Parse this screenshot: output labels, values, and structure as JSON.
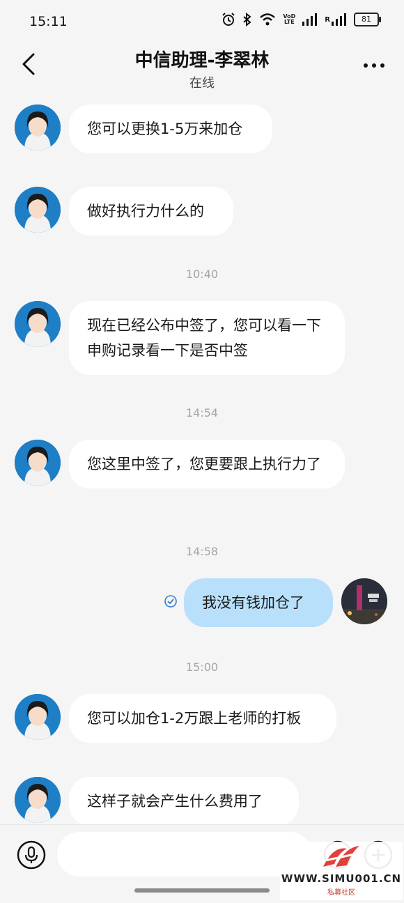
{
  "status_bar": {
    "time": "15:11",
    "network_labels": [
      "VoD",
      "LTE",
      "R"
    ],
    "battery_level": "81",
    "icons": [
      "alarm-icon",
      "bluetooth-icon",
      "wifi-icon",
      "signal-icon",
      "signal-icon",
      "battery-icon"
    ]
  },
  "header": {
    "title": "中信助理-李翠林",
    "subtitle": "在线",
    "back_icon": "back-icon",
    "more_icon": "more-icon"
  },
  "messages": [
    {
      "type": "received",
      "text": "您可以更换1-5万来加仓"
    },
    {
      "type": "received",
      "text": "做好执行力什么的"
    },
    {
      "type": "timestamp",
      "text": "10:40"
    },
    {
      "type": "received",
      "text": "现在已经公布中签了，您可以看一下申购记录看一下是否中签"
    },
    {
      "type": "timestamp",
      "text": "14:54"
    },
    {
      "type": "received",
      "text": "您这里中签了，您更要跟上执行力了"
    },
    {
      "type": "timestamp",
      "text": "14:58"
    },
    {
      "type": "sent",
      "text": "我没有钱加仓了"
    },
    {
      "type": "timestamp",
      "text": "15:00"
    },
    {
      "type": "received",
      "text": "您可以加仓1-2万跟上老师的打板"
    },
    {
      "type": "received",
      "text": "这样子就会产生什么费用了"
    }
  ],
  "input_bar": {
    "placeholder": "",
    "icons": [
      "microphone-icon",
      "emoji-icon",
      "plus-icon"
    ]
  },
  "watermark": {
    "text": "WWW.SIMU001.CN",
    "sub": "私募社区"
  },
  "colors": {
    "background": "#f5f5f5",
    "received_bubble": "#ffffff",
    "sent_bubble": "#b9e0fb",
    "accent": "#2f7fd6"
  }
}
